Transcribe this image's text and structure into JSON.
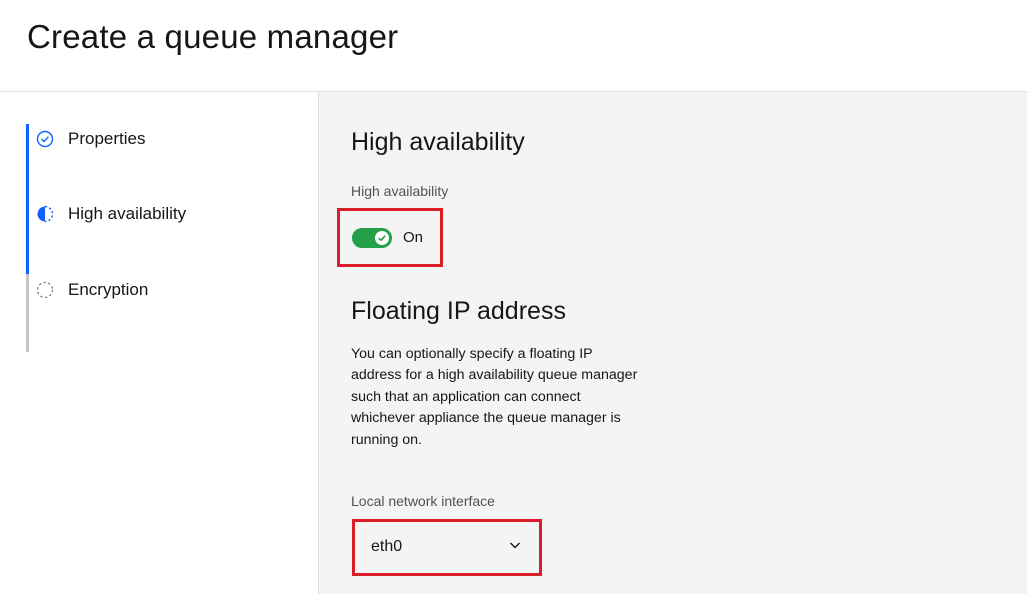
{
  "page": {
    "title": "Create a queue manager"
  },
  "steps": [
    {
      "label": "Properties",
      "state": "complete",
      "icon": "checkmark-circle-icon"
    },
    {
      "label": "High availability",
      "state": "current",
      "icon": "half-circle-icon"
    },
    {
      "label": "Encryption",
      "state": "incomplete",
      "icon": "dashed-circle-icon"
    }
  ],
  "high_availability": {
    "heading": "High availability",
    "field_label": "High availability",
    "toggle_state": "On",
    "toggle_on": true
  },
  "floating_ip": {
    "heading": "Floating IP address",
    "description": "You can optionally specify a floating IP address for a high availability queue manager such that an application can connect whichever appliance the queue manager is running on.",
    "interface_label": "Local network interface",
    "interface_value": "eth0"
  },
  "colors": {
    "accent_blue": "#0f62fe",
    "toggle_green": "#24a148",
    "highlight_red": "#da1e28",
    "content_bg": "#f4f4f4"
  }
}
